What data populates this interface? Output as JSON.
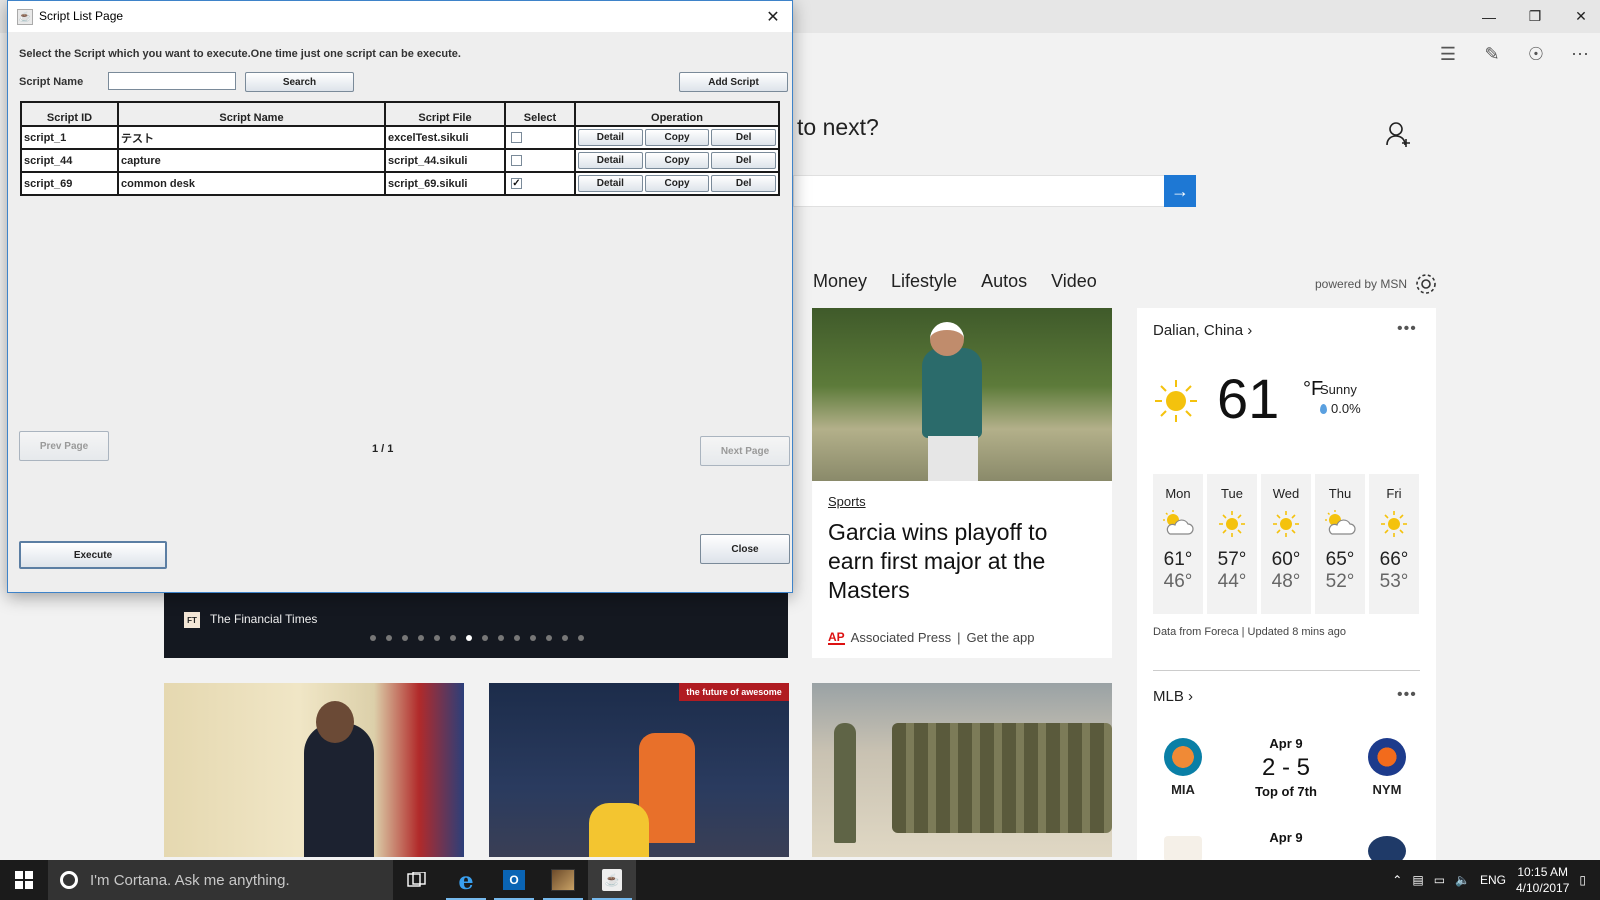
{
  "edge": {
    "question": "to next?",
    "categories": [
      "Money",
      "Lifestyle",
      "Autos",
      "Video"
    ],
    "powered_by": "powered by MSN",
    "golf": {
      "tag": "Sports",
      "headline": "Garcia wins playoff to earn first major at the Masters",
      "source": "Associated Press",
      "get_app": "Get the app",
      "logo": "AP"
    },
    "weather": {
      "city": "Dalian, China",
      "temp": "61",
      "unit": "°F",
      "condition": "Sunny",
      "precip": "0.0%",
      "days": [
        {
          "name": "Mon",
          "hi": "61°",
          "lo": "46°",
          "icon": "partly-cloudy-icon"
        },
        {
          "name": "Tue",
          "hi": "57°",
          "lo": "44°",
          "icon": "sun-icon"
        },
        {
          "name": "Wed",
          "hi": "60°",
          "lo": "48°",
          "icon": "sun-icon"
        },
        {
          "name": "Thu",
          "hi": "65°",
          "lo": "52°",
          "icon": "partly-cloudy-icon"
        },
        {
          "name": "Fri",
          "hi": "66°",
          "lo": "53°",
          "icon": "sun-icon"
        }
      ],
      "footer": "Data from Foreca | Updated 8 mins ago"
    },
    "mlb": {
      "title": "MLB",
      "game1": {
        "date": "Apr 9",
        "score": "2 - 5",
        "status": "Top of 7th",
        "away": "MIA",
        "home": "NYM"
      },
      "game2": {
        "date": "Apr 9"
      }
    },
    "ft": {
      "logo": "FT",
      "source": "The Financial Times"
    },
    "photo2_banner": "the future of awesome"
  },
  "dialog": {
    "title": "Script List Page",
    "instruction": "Select the Script which you want to execute.One time just one script can be execute.",
    "name_label": "Script Name",
    "name_value": "",
    "search_label": "Search",
    "add_label": "Add Script",
    "columns": [
      "Script ID",
      "Script Name",
      "Script File",
      "Select",
      "Operation"
    ],
    "rows": [
      {
        "id": "script_1",
        "name": "テスト",
        "file": "excelTest.sikuli",
        "selected": false
      },
      {
        "id": "script_44",
        "name": "capture",
        "file": "script_44.sikuli",
        "selected": false
      },
      {
        "id": "script_69",
        "name": "common desk",
        "file": "script_69.sikuli",
        "selected": true
      }
    ],
    "op_labels": {
      "detail": "Detail",
      "copy": "Copy",
      "del": "Del"
    },
    "prev_label": "Prev Page",
    "next_label": "Next Page",
    "page_info": "1 / 1",
    "execute_label": "Execute",
    "close_label": "Close"
  },
  "taskbar": {
    "cortana": "I'm Cortana. Ask me anything.",
    "lang": "ENG",
    "time": "10:15 AM",
    "date": "4/10/2017"
  }
}
